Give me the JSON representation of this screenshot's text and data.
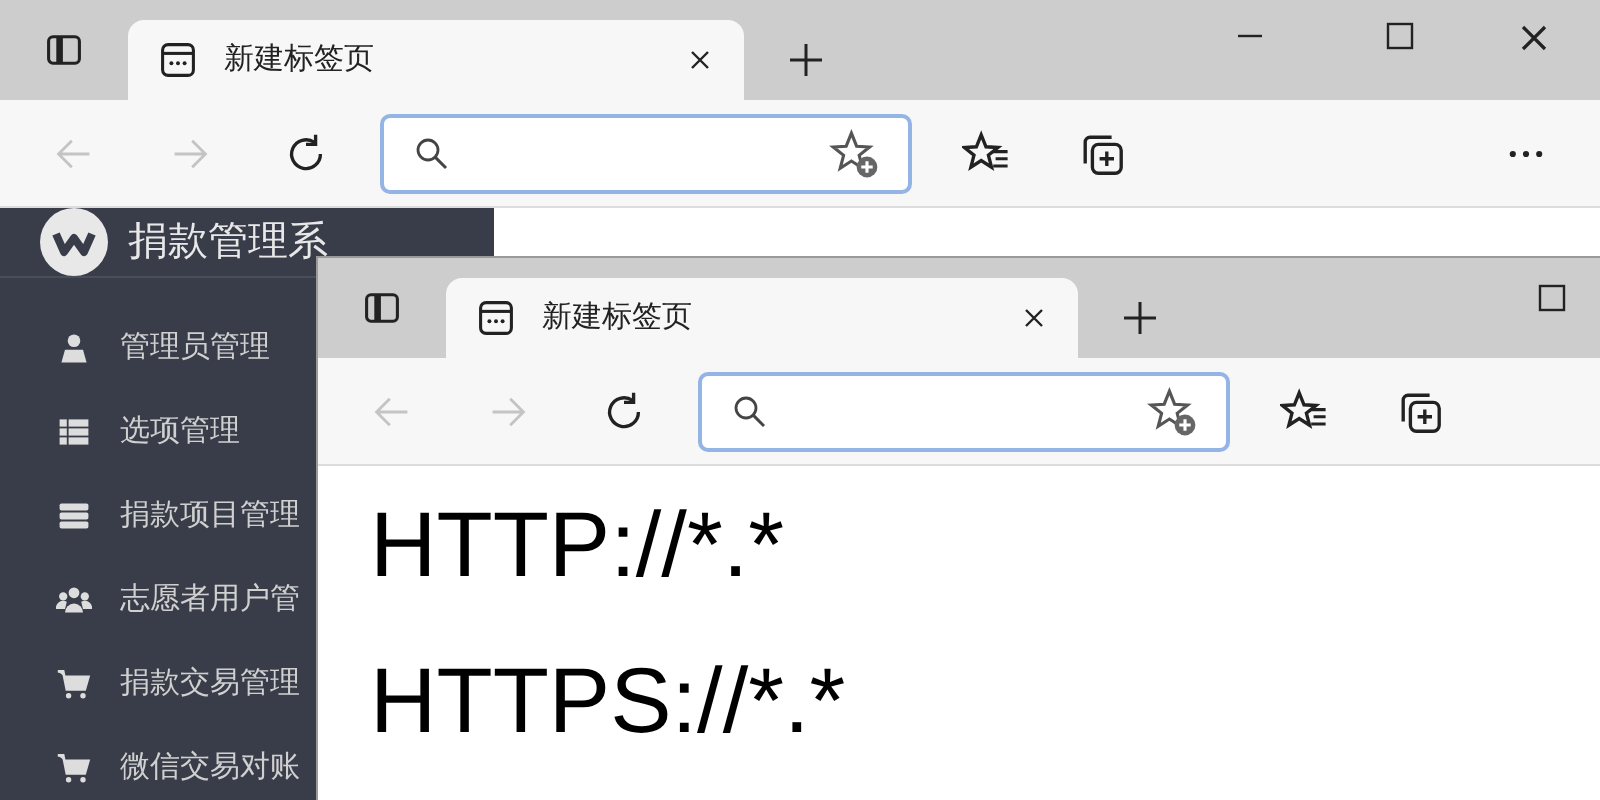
{
  "back_window": {
    "tab": {
      "title": "新建标签页",
      "selected": true
    },
    "nav": {
      "back_disabled": true,
      "forward_disabled": true
    },
    "sidebar": {
      "title": "捐款管理系",
      "items": [
        {
          "label": "管理员管理"
        },
        {
          "label": "选项管理"
        },
        {
          "label": "捐款项目管理"
        },
        {
          "label": "志愿者用户管"
        },
        {
          "label": "捐款交易管理"
        },
        {
          "label": "微信交易对账"
        }
      ]
    }
  },
  "front_window": {
    "tab": {
      "title": "新建标签页",
      "selected": true
    },
    "nav": {
      "back_disabled": true,
      "forward_disabled": true
    },
    "page_lines": [
      "HTTP://*.*",
      "HTTPS://*.*"
    ]
  }
}
